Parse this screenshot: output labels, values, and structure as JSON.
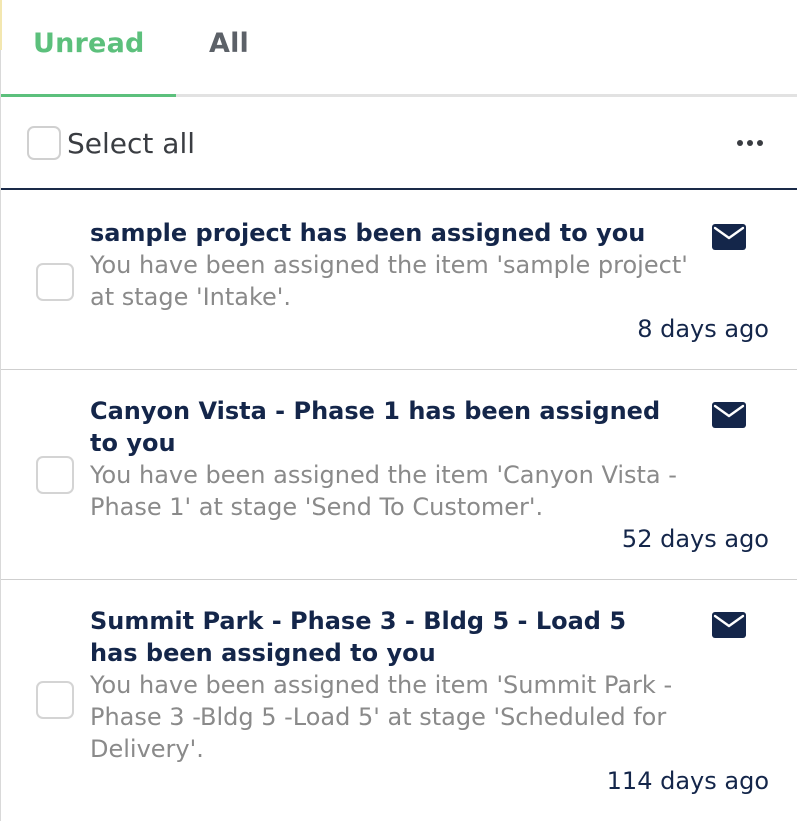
{
  "tabs": [
    {
      "label": "Unread",
      "active": true
    },
    {
      "label": "All",
      "active": false
    }
  ],
  "toolbar": {
    "select_all_label": "Select all",
    "more_icon": "more-horizontal-icon"
  },
  "colors": {
    "accent": "#5cc07c",
    "navy": "#14264a",
    "muted_text": "#8a8a8a"
  },
  "notifications": [
    {
      "title": "sample project has been assigned to you",
      "body": "You have been assigned the item 'sample project' at stage 'Intake'.",
      "time": "8 days ago",
      "icon": "mail-icon"
    },
    {
      "title": "Canyon Vista - Phase 1 has been assigned to you",
      "body": "You have been assigned the item 'Canyon Vista -Phase 1' at stage 'Send To Customer'.",
      "time": "52 days ago",
      "icon": "mail-icon"
    },
    {
      "title": "Summit Park - Phase 3 - Bldg 5 - Load 5 has been assigned to you",
      "body": "You have been assigned the item 'Summit Park -Phase 3 -Bldg 5 -Load 5' at stage 'Scheduled for Delivery'.",
      "time": "114 days ago",
      "icon": "mail-icon"
    }
  ]
}
